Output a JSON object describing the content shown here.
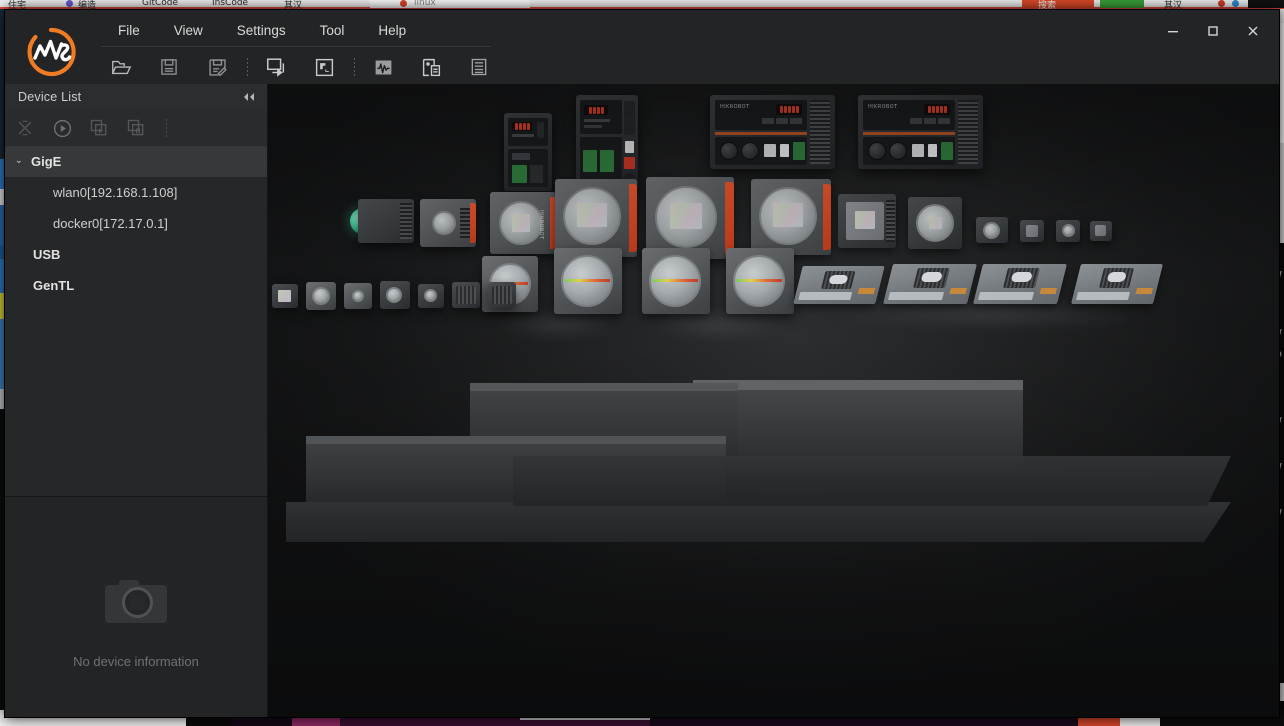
{
  "window": {
    "app_title": "MVS",
    "logo_text": "MVS",
    "logo_color": "#ef7c23",
    "accent_color": "#ef7c23"
  },
  "menubar": {
    "items": [
      {
        "label": "File",
        "name": "menu-file"
      },
      {
        "label": "View",
        "name": "menu-view"
      },
      {
        "label": "Settings",
        "name": "menu-settings"
      },
      {
        "label": "Tool",
        "name": "menu-tool"
      },
      {
        "label": "Help",
        "name": "menu-help"
      }
    ]
  },
  "window_controls": {
    "minimize": "—",
    "maximize": "□",
    "close": "✕"
  },
  "toolbar": {
    "buttons": [
      {
        "icon": "open-folder-icon",
        "label": "Open"
      },
      {
        "icon": "save-icon",
        "label": "Save"
      },
      {
        "icon": "save-as-icon",
        "label": "Save As"
      },
      {
        "icon": "import-export-icon",
        "label": "Import/Export"
      },
      {
        "icon": "roi-frame-icon",
        "label": "ROI"
      },
      {
        "icon": "waveform-icon",
        "label": "Waveform"
      },
      {
        "icon": "image-info-icon",
        "label": "Image Information"
      },
      {
        "icon": "log-list-icon",
        "label": "Log"
      }
    ]
  },
  "sidebar": {
    "title": "Device List",
    "collapse_icon": "◂◂",
    "toolbar_buttons": [
      {
        "icon": "refresh-devices-icon",
        "label": "Refresh Device List"
      },
      {
        "icon": "play-icon",
        "label": "Start Acquisition"
      },
      {
        "icon": "batch-start-icon",
        "label": "Batch Start"
      },
      {
        "icon": "batch-stop-icon",
        "label": "Batch Stop"
      }
    ],
    "tree": [
      {
        "label": "GigE",
        "type": "group",
        "expanded": true,
        "selected": true,
        "chevron": "⌄",
        "children": [
          {
            "label": "wlan0[192.168.1.108]",
            "type": "interface"
          },
          {
            "label": "docker0[172.17.0.1]",
            "type": "interface"
          }
        ]
      },
      {
        "label": "USB",
        "type": "group",
        "expanded": false,
        "selected": false,
        "children": []
      },
      {
        "label": "GenTL",
        "type": "group",
        "expanded": false,
        "selected": false,
        "children": []
      }
    ],
    "empty_state": {
      "icon": "camera-placeholder-icon",
      "text": "No device information"
    }
  },
  "display": {
    "name": "splash-image",
    "description": "Industrial machine-vision product family splash image",
    "brand": "HIKROBOT",
    "background_color": "#121212"
  }
}
